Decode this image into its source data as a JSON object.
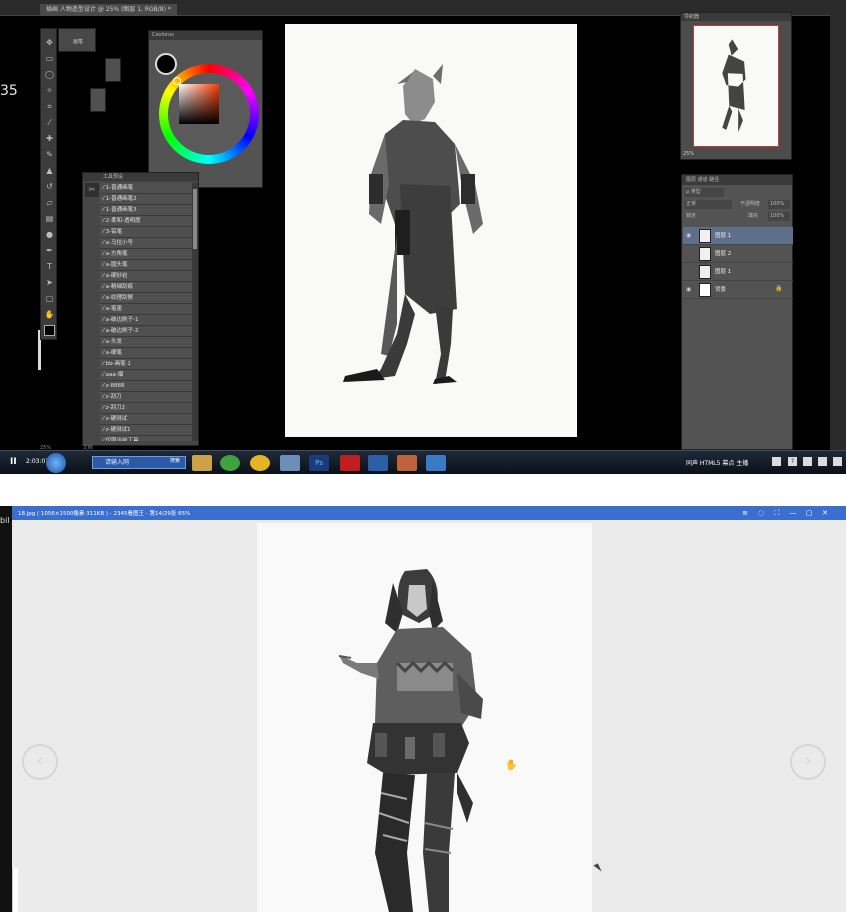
{
  "photoshop": {
    "doc_tab": "插画 人物造型设计 @ 25% (图层 1, RGB/8) *",
    "side_number": "35",
    "preset_label": "画笔",
    "color_panel_title": "Coolorus",
    "brush_panel_title": "工具预设",
    "brush_presets": [
      "1-普通画笔",
      "1-普通画笔2",
      "1-普通画笔3",
      "2-柔和-透明度",
      "3-铅笔",
      "a-马拉小号",
      "a-方角笔",
      "a-圆头笔",
      "a-硬砂岩",
      "a-精细刮痕",
      "a-纹理刮擦",
      "a-笔墨",
      "a-破边刷子-1",
      "a-破边刷子-2",
      "a-头发",
      "a-硬笔",
      "bb-画笔 1",
      "aaa-烟",
      "z-8888",
      "z-刮刀",
      "z-刮刀2",
      "z-硬测试",
      "z-硬测试1",
      "仅限当前工具"
    ],
    "status_zoom": "25%",
    "status_doc": "文档",
    "navigator_title": "导航器",
    "navigator_zoom": "25%",
    "layers": {
      "tabs": "图层  通道  路径",
      "kind": "p 类型",
      "blend_mode": "正常",
      "opacity_label": "不透明度",
      "opacity_value": "100%",
      "lock_label": "锁定",
      "fill_label": "填充",
      "fill_value": "100%",
      "items": [
        {
          "name": "图层 1",
          "selected": true
        },
        {
          "name": "图层 2",
          "selected": false
        },
        {
          "name": "图层 1",
          "selected": false
        },
        {
          "name": "背景",
          "selected": false
        }
      ]
    }
  },
  "taskbar": {
    "pause": "II",
    "time": "2:03:07",
    "search_placeholder": "请输入网",
    "search_button": "搜索",
    "tray_text": "同声  HTML5   幕点 主播"
  },
  "viewer": {
    "left_label": "bil",
    "title": "18.jpg ( 1056×1500像素  311KB ) - 2345看图王 - 第14/29张 65%",
    "prev_symbol": "‹",
    "next_symbol": "›",
    "window_buttons": [
      "≡",
      "◌",
      "⛶",
      "—",
      "▢",
      "✕"
    ]
  }
}
